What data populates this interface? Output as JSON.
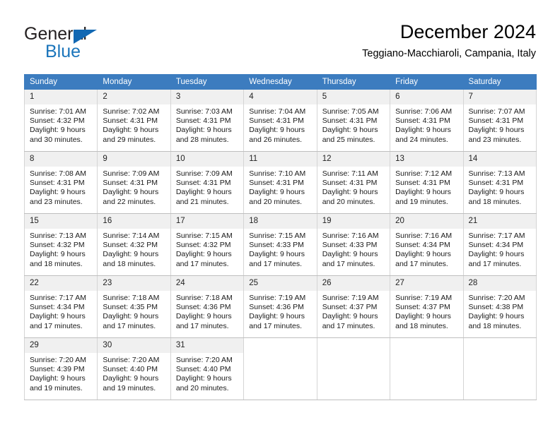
{
  "brand": {
    "word_one": "General",
    "word_two": "Blue",
    "triangle_icon": "triangle-icon"
  },
  "header": {
    "title": "December 2024",
    "location": "Teggiano-Macchiaroli, Campania, Italy"
  },
  "colors": {
    "header_blue": "#3c7cbf",
    "brand_blue": "#1b75bb",
    "daynum_bg": "#f0f0f0",
    "grid_border": "#bfbfbf"
  },
  "calendar": {
    "weekday_headers": [
      "Sunday",
      "Monday",
      "Tuesday",
      "Wednesday",
      "Thursday",
      "Friday",
      "Saturday"
    ],
    "weeks": [
      [
        {
          "day": "1",
          "sunrise": "Sunrise: 7:01 AM",
          "sunset": "Sunset: 4:32 PM",
          "daylight_line1": "Daylight: 9 hours",
          "daylight_line2": "and 30 minutes."
        },
        {
          "day": "2",
          "sunrise": "Sunrise: 7:02 AM",
          "sunset": "Sunset: 4:31 PM",
          "daylight_line1": "Daylight: 9 hours",
          "daylight_line2": "and 29 minutes."
        },
        {
          "day": "3",
          "sunrise": "Sunrise: 7:03 AM",
          "sunset": "Sunset: 4:31 PM",
          "daylight_line1": "Daylight: 9 hours",
          "daylight_line2": "and 28 minutes."
        },
        {
          "day": "4",
          "sunrise": "Sunrise: 7:04 AM",
          "sunset": "Sunset: 4:31 PM",
          "daylight_line1": "Daylight: 9 hours",
          "daylight_line2": "and 26 minutes."
        },
        {
          "day": "5",
          "sunrise": "Sunrise: 7:05 AM",
          "sunset": "Sunset: 4:31 PM",
          "daylight_line1": "Daylight: 9 hours",
          "daylight_line2": "and 25 minutes."
        },
        {
          "day": "6",
          "sunrise": "Sunrise: 7:06 AM",
          "sunset": "Sunset: 4:31 PM",
          "daylight_line1": "Daylight: 9 hours",
          "daylight_line2": "and 24 minutes."
        },
        {
          "day": "7",
          "sunrise": "Sunrise: 7:07 AM",
          "sunset": "Sunset: 4:31 PM",
          "daylight_line1": "Daylight: 9 hours",
          "daylight_line2": "and 23 minutes."
        }
      ],
      [
        {
          "day": "8",
          "sunrise": "Sunrise: 7:08 AM",
          "sunset": "Sunset: 4:31 PM",
          "daylight_line1": "Daylight: 9 hours",
          "daylight_line2": "and 23 minutes."
        },
        {
          "day": "9",
          "sunrise": "Sunrise: 7:09 AM",
          "sunset": "Sunset: 4:31 PM",
          "daylight_line1": "Daylight: 9 hours",
          "daylight_line2": "and 22 minutes."
        },
        {
          "day": "10",
          "sunrise": "Sunrise: 7:09 AM",
          "sunset": "Sunset: 4:31 PM",
          "daylight_line1": "Daylight: 9 hours",
          "daylight_line2": "and 21 minutes."
        },
        {
          "day": "11",
          "sunrise": "Sunrise: 7:10 AM",
          "sunset": "Sunset: 4:31 PM",
          "daylight_line1": "Daylight: 9 hours",
          "daylight_line2": "and 20 minutes."
        },
        {
          "day": "12",
          "sunrise": "Sunrise: 7:11 AM",
          "sunset": "Sunset: 4:31 PM",
          "daylight_line1": "Daylight: 9 hours",
          "daylight_line2": "and 20 minutes."
        },
        {
          "day": "13",
          "sunrise": "Sunrise: 7:12 AM",
          "sunset": "Sunset: 4:31 PM",
          "daylight_line1": "Daylight: 9 hours",
          "daylight_line2": "and 19 minutes."
        },
        {
          "day": "14",
          "sunrise": "Sunrise: 7:13 AM",
          "sunset": "Sunset: 4:31 PM",
          "daylight_line1": "Daylight: 9 hours",
          "daylight_line2": "and 18 minutes."
        }
      ],
      [
        {
          "day": "15",
          "sunrise": "Sunrise: 7:13 AM",
          "sunset": "Sunset: 4:32 PM",
          "daylight_line1": "Daylight: 9 hours",
          "daylight_line2": "and 18 minutes."
        },
        {
          "day": "16",
          "sunrise": "Sunrise: 7:14 AM",
          "sunset": "Sunset: 4:32 PM",
          "daylight_line1": "Daylight: 9 hours",
          "daylight_line2": "and 18 minutes."
        },
        {
          "day": "17",
          "sunrise": "Sunrise: 7:15 AM",
          "sunset": "Sunset: 4:32 PM",
          "daylight_line1": "Daylight: 9 hours",
          "daylight_line2": "and 17 minutes."
        },
        {
          "day": "18",
          "sunrise": "Sunrise: 7:15 AM",
          "sunset": "Sunset: 4:33 PM",
          "daylight_line1": "Daylight: 9 hours",
          "daylight_line2": "and 17 minutes."
        },
        {
          "day": "19",
          "sunrise": "Sunrise: 7:16 AM",
          "sunset": "Sunset: 4:33 PM",
          "daylight_line1": "Daylight: 9 hours",
          "daylight_line2": "and 17 minutes."
        },
        {
          "day": "20",
          "sunrise": "Sunrise: 7:16 AM",
          "sunset": "Sunset: 4:34 PM",
          "daylight_line1": "Daylight: 9 hours",
          "daylight_line2": "and 17 minutes."
        },
        {
          "day": "21",
          "sunrise": "Sunrise: 7:17 AM",
          "sunset": "Sunset: 4:34 PM",
          "daylight_line1": "Daylight: 9 hours",
          "daylight_line2": "and 17 minutes."
        }
      ],
      [
        {
          "day": "22",
          "sunrise": "Sunrise: 7:17 AM",
          "sunset": "Sunset: 4:34 PM",
          "daylight_line1": "Daylight: 9 hours",
          "daylight_line2": "and 17 minutes."
        },
        {
          "day": "23",
          "sunrise": "Sunrise: 7:18 AM",
          "sunset": "Sunset: 4:35 PM",
          "daylight_line1": "Daylight: 9 hours",
          "daylight_line2": "and 17 minutes."
        },
        {
          "day": "24",
          "sunrise": "Sunrise: 7:18 AM",
          "sunset": "Sunset: 4:36 PM",
          "daylight_line1": "Daylight: 9 hours",
          "daylight_line2": "and 17 minutes."
        },
        {
          "day": "25",
          "sunrise": "Sunrise: 7:19 AM",
          "sunset": "Sunset: 4:36 PM",
          "daylight_line1": "Daylight: 9 hours",
          "daylight_line2": "and 17 minutes."
        },
        {
          "day": "26",
          "sunrise": "Sunrise: 7:19 AM",
          "sunset": "Sunset: 4:37 PM",
          "daylight_line1": "Daylight: 9 hours",
          "daylight_line2": "and 17 minutes."
        },
        {
          "day": "27",
          "sunrise": "Sunrise: 7:19 AM",
          "sunset": "Sunset: 4:37 PM",
          "daylight_line1": "Daylight: 9 hours",
          "daylight_line2": "and 18 minutes."
        },
        {
          "day": "28",
          "sunrise": "Sunrise: 7:20 AM",
          "sunset": "Sunset: 4:38 PM",
          "daylight_line1": "Daylight: 9 hours",
          "daylight_line2": "and 18 minutes."
        }
      ],
      [
        {
          "day": "29",
          "sunrise": "Sunrise: 7:20 AM",
          "sunset": "Sunset: 4:39 PM",
          "daylight_line1": "Daylight: 9 hours",
          "daylight_line2": "and 19 minutes."
        },
        {
          "day": "30",
          "sunrise": "Sunrise: 7:20 AM",
          "sunset": "Sunset: 4:40 PM",
          "daylight_line1": "Daylight: 9 hours",
          "daylight_line2": "and 19 minutes."
        },
        {
          "day": "31",
          "sunrise": "Sunrise: 7:20 AM",
          "sunset": "Sunset: 4:40 PM",
          "daylight_line1": "Daylight: 9 hours",
          "daylight_line2": "and 20 minutes."
        },
        {
          "day": "",
          "sunrise": "",
          "sunset": "",
          "daylight_line1": "",
          "daylight_line2": ""
        },
        {
          "day": "",
          "sunrise": "",
          "sunset": "",
          "daylight_line1": "",
          "daylight_line2": ""
        },
        {
          "day": "",
          "sunrise": "",
          "sunset": "",
          "daylight_line1": "",
          "daylight_line2": ""
        },
        {
          "day": "",
          "sunrise": "",
          "sunset": "",
          "daylight_line1": "",
          "daylight_line2": ""
        }
      ]
    ]
  }
}
